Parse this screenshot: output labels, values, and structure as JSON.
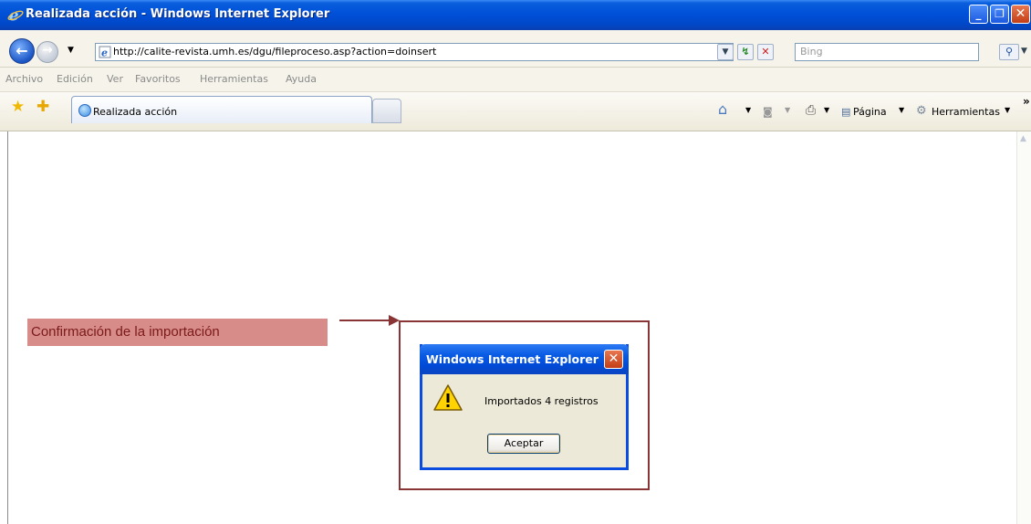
{
  "window": {
    "title": "Realizada acción - Windows Internet Explorer"
  },
  "address": {
    "url": "http://calite-revista.umh.es/dgu/fileproceso.asp?action=doinsert"
  },
  "search": {
    "placeholder": "Bing"
  },
  "menu": [
    "Archivo",
    "Edición",
    "Ver",
    "Favoritos",
    "Herramientas",
    "Ayuda"
  ],
  "tab": {
    "label": "Realizada acción"
  },
  "commandbar": {
    "page_label": "Página",
    "tools_label": "Herramientas",
    "more": "»"
  },
  "annotation": {
    "text": "Confirmación de la importación"
  },
  "dialog": {
    "title": "Windows Internet Explorer",
    "message": "Importados 4 registros",
    "button": "Aceptar"
  },
  "colors": {
    "titlebar": "#0050d8",
    "annotation_fill": "#d88c8a",
    "callout_border": "#8a3535"
  }
}
